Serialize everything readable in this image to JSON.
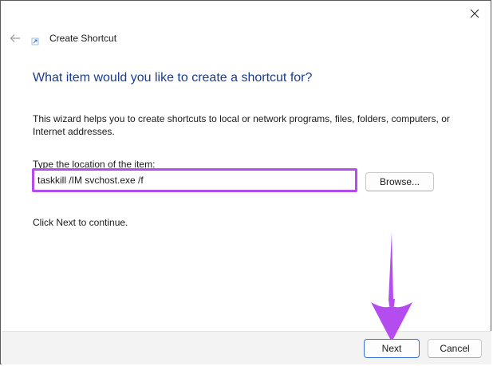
{
  "window": {
    "title": "Create Shortcut",
    "close_icon": "close-icon",
    "back_icon": "back-arrow-icon"
  },
  "page": {
    "heading": "What item would you like to create a shortcut for?",
    "description": "This wizard helps you to create shortcuts to local or network programs, files, folders, computers, or Internet addresses.",
    "field_label": "Type the location of the item:",
    "location_value": "taskkill /IM svchost.exe /f",
    "browse_label": "Browse...",
    "hint": "Click Next to continue."
  },
  "footer": {
    "next_label": "Next",
    "cancel_label": "Cancel"
  },
  "colors": {
    "heading": "#1a3d8f",
    "highlight": "#b44cf0",
    "annotation_arrow": "#b44cf0",
    "footer_bg": "#f3f3f3"
  }
}
